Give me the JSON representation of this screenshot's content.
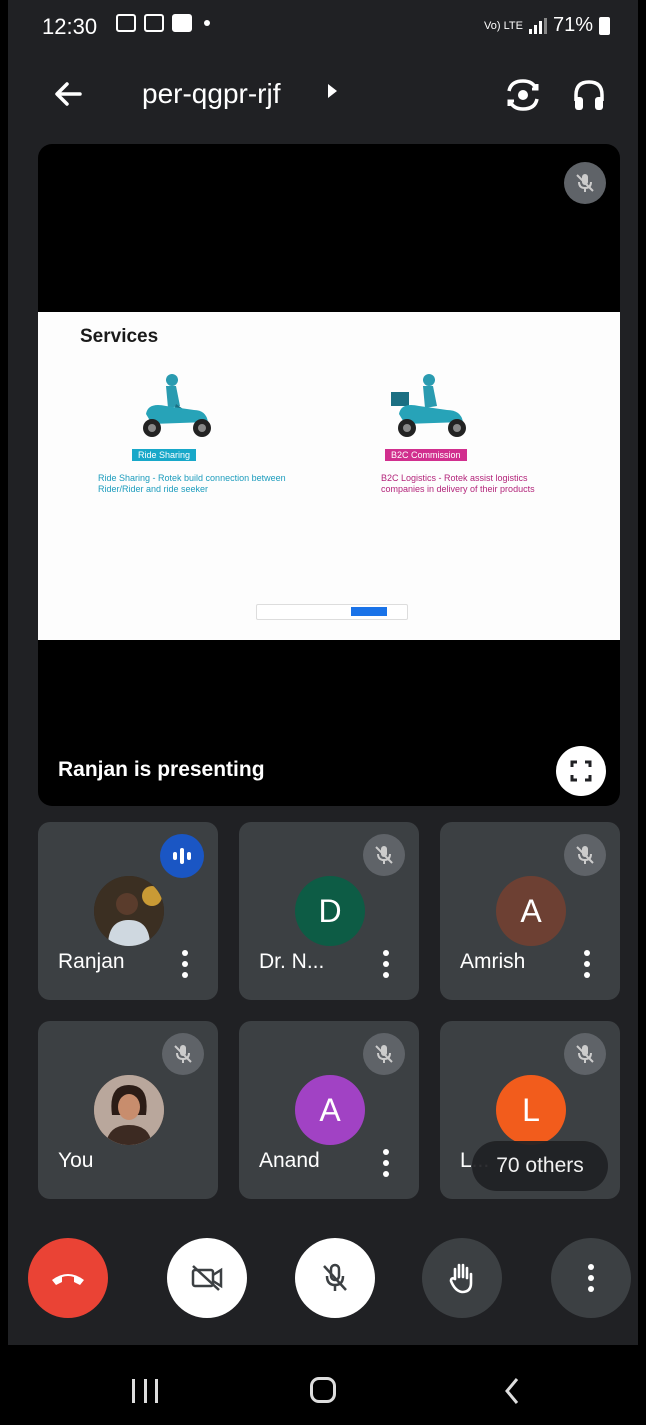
{
  "status_bar": {
    "time": "12:30",
    "network": "Vo) LTE",
    "battery": "71%"
  },
  "header": {
    "meeting_code": "per-qgpr-rjf"
  },
  "presentation": {
    "slide": {
      "title": "Services",
      "service_1": {
        "tag": "Ride Sharing",
        "description": "Ride Sharing - Rotek build connection between Rider/Rider and ride seeker"
      },
      "service_2": {
        "tag": "B2C Commission",
        "description": "B2C Logistics - Rotek assist logistics companies in delivery of their products"
      }
    },
    "presenting_label": "Ranjan is presenting"
  },
  "participants": [
    {
      "name": "Ranjan",
      "initial": "",
      "avatar_color": "#3a3a3a",
      "status": "speaking"
    },
    {
      "name": "Dr. N...",
      "initial": "D",
      "avatar_color": "#0d5c45",
      "status": "muted"
    },
    {
      "name": "Amrish",
      "initial": "A",
      "avatar_color": "#6d4033",
      "status": "muted"
    },
    {
      "name": "You",
      "initial": "",
      "avatar_color": "#8a6a5a",
      "status": "muted"
    },
    {
      "name": "Anand",
      "initial": "A",
      "avatar_color": "#a142c4",
      "status": "muted"
    },
    {
      "name": "L...",
      "initial": "L",
      "avatar_color": "#f25c1c",
      "status": "muted"
    }
  ],
  "others_label": "70 others",
  "colors": {
    "background": "#202124",
    "tile": "#3c4043",
    "end_call": "#ea4335",
    "speaking": "#1a56c4"
  },
  "controls": {
    "icons": [
      "end-call-icon",
      "camera-off-icon",
      "mic-off-icon",
      "raise-hand-icon",
      "more-vert-icon"
    ]
  }
}
